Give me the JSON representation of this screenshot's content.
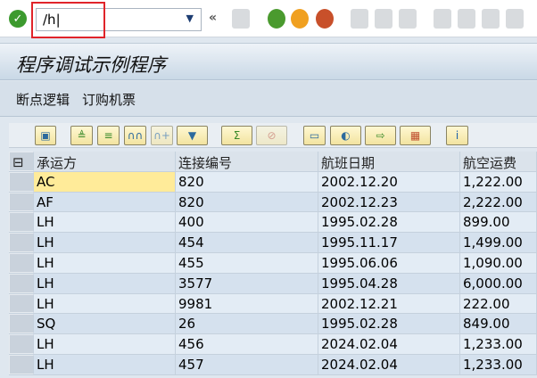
{
  "command_field": {
    "value": "/h"
  },
  "toolbar": {
    "back": "«"
  },
  "title": "程序调试示例程序",
  "menu": [
    "断点逻辑",
    "订购机票"
  ],
  "table": {
    "columns": [
      "承运方",
      "连接编号",
      "航班日期",
      "航空运费"
    ],
    "rows": [
      [
        "AC",
        "820",
        "2002.12.20",
        "1,222.00"
      ],
      [
        "AF",
        "820",
        "2002.12.23",
        "2,222.00"
      ],
      [
        "LH",
        "400",
        "1995.02.28",
        "899.00"
      ],
      [
        "LH",
        "454",
        "1995.11.17",
        "1,499.00"
      ],
      [
        "LH",
        "455",
        "1995.06.06",
        "1,090.00"
      ],
      [
        "LH",
        "3577",
        "1995.04.28",
        "6,000.00"
      ],
      [
        "LH",
        "9981",
        "2002.12.21",
        "222.00"
      ],
      [
        "SQ",
        "26",
        "1995.02.28",
        "849.00"
      ],
      [
        "LH",
        "456",
        "2024.02.04",
        "1,233.00"
      ],
      [
        "LH",
        "457",
        "2024.02.04",
        "1,233.00"
      ]
    ]
  },
  "colors": {
    "accent": "#e0242a",
    "title_bg": "#c9d8e6",
    "selected_cell": "#ffeb99"
  }
}
